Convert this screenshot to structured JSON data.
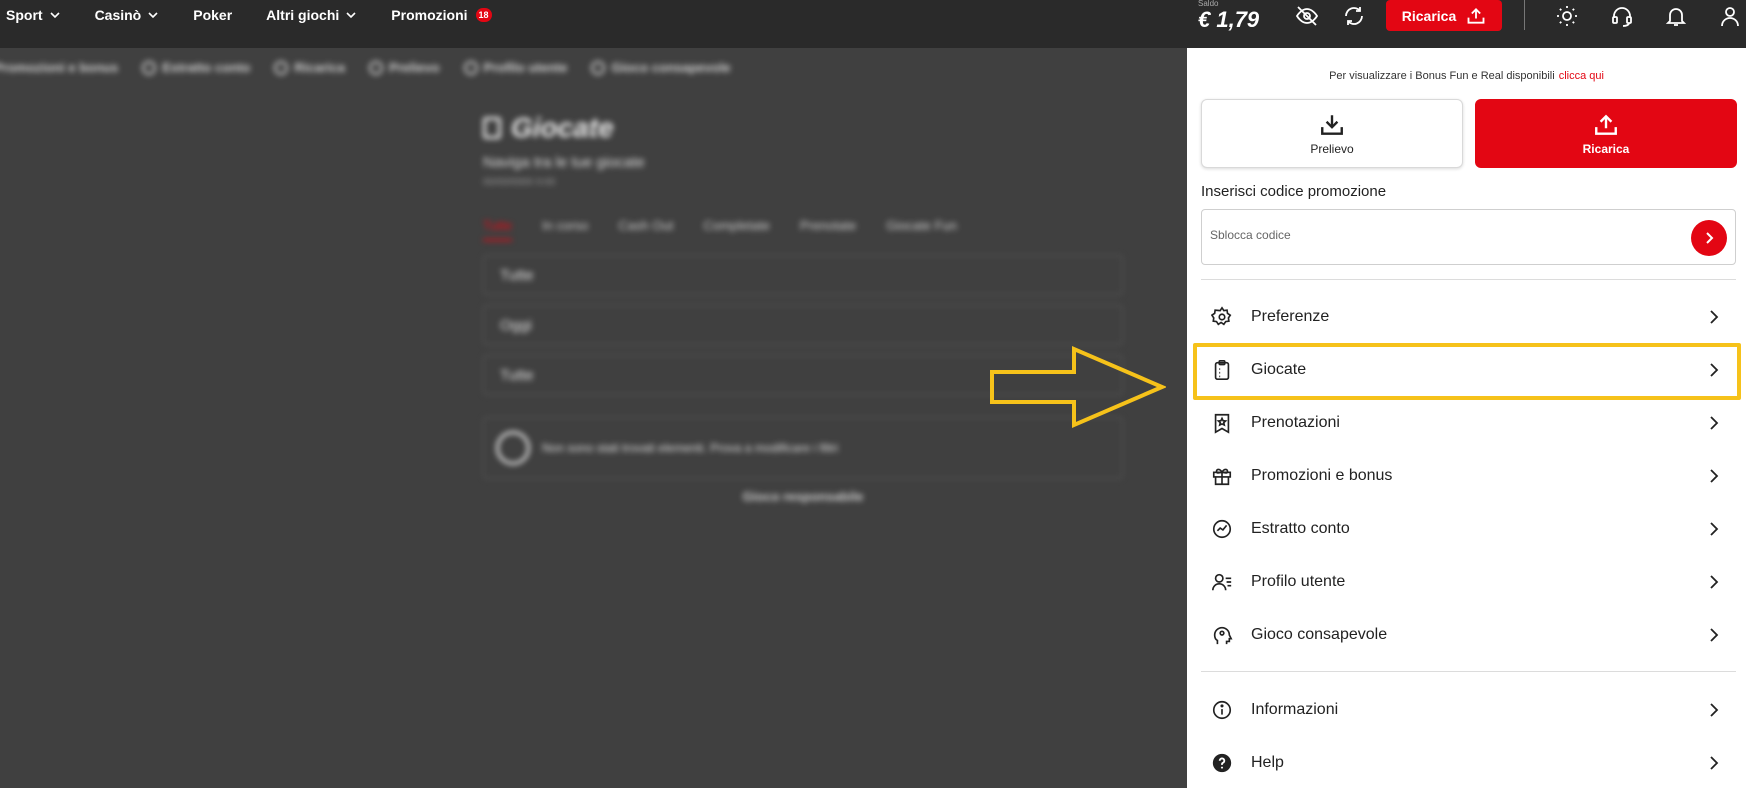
{
  "topbar": {
    "nav": [
      {
        "label": "Sport",
        "dropdown": true
      },
      {
        "label": "Casinò",
        "dropdown": true
      },
      {
        "label": "Poker",
        "dropdown": false
      },
      {
        "label": "Altri giochi",
        "dropdown": true
      },
      {
        "label": "Promozioni",
        "dropdown": false,
        "badge": "18"
      }
    ],
    "balance_label": "Saldo",
    "balance_value": "€ 1,79",
    "recharge_label": "Ricarica",
    "icons": [
      "hide-balance-icon",
      "refresh-icon",
      "upload-icon",
      "sun-icon",
      "support-icon",
      "bell-icon",
      "user-icon"
    ]
  },
  "background": {
    "subnav": [
      "Promozioni e bonus",
      "Estratto conto",
      "Ricarica",
      "Prelievo",
      "Profilo utente",
      "Gioco consapevole"
    ],
    "title": "Giocate",
    "subtitle": "Naviga tra le tue giocate",
    "date": "00/00/0000 0:00",
    "tabs": [
      "Tutte",
      "In corso",
      "Cash Out",
      "Completate",
      "Prenotate",
      "Giocate Fun"
    ],
    "filters": [
      "Tutte",
      "Oggi",
      "Tutte"
    ],
    "empty_message": "Non sono stati trovati elementi. Prova a modificare i filtri",
    "responsible_link": "Gioco responsabile"
  },
  "drawer": {
    "info_text": "Per visualizzare i Bonus Fun e Real disponibili",
    "info_link": "clicca qui",
    "withdraw_label": "Prelievo",
    "recharge_label": "Ricarica",
    "promo_label": "Inserisci codice promozione",
    "promo_placeholder": "Sblocca codice",
    "menu": [
      {
        "label": "Preferenze",
        "icon": "gear-icon"
      },
      {
        "label": "Giocate",
        "icon": "clipboard-icon"
      },
      {
        "label": "Prenotazioni",
        "icon": "bookmark-star-icon"
      },
      {
        "label": "Promozioni e bonus",
        "icon": "gift-icon"
      },
      {
        "label": "Estratto conto",
        "icon": "chart-circle-icon"
      },
      {
        "label": "Profilo utente",
        "icon": "user-list-icon"
      },
      {
        "label": "Gioco consapevole",
        "icon": "head-icon"
      }
    ],
    "menu_secondary": [
      {
        "label": "Informazioni",
        "icon": "info-icon"
      },
      {
        "label": "Help",
        "icon": "help-icon"
      }
    ],
    "highlighted_item": "Giocate"
  },
  "colors": {
    "accent": "#e30613",
    "highlight": "#f6c21a",
    "topbar": "#2a2a2a",
    "backdrop": "#404040"
  }
}
